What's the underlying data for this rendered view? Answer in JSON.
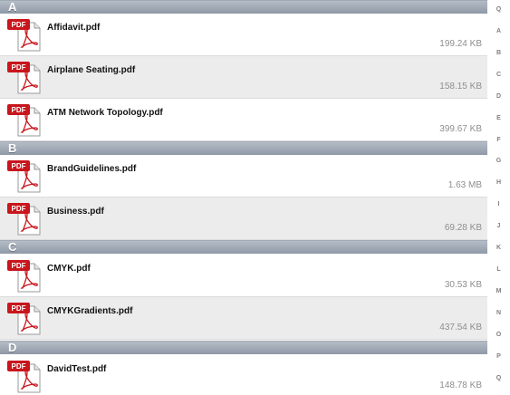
{
  "sections": [
    {
      "letter": "A",
      "files": [
        {
          "name": "Affidavit.pdf",
          "size": "199.24 KB"
        },
        {
          "name": "Airplane Seating.pdf",
          "size": "158.15 KB"
        },
        {
          "name": "ATM Network Topology.pdf",
          "size": "399.67 KB"
        }
      ]
    },
    {
      "letter": "B",
      "files": [
        {
          "name": "BrandGuidelines.pdf",
          "size": "1.63 MB"
        },
        {
          "name": "Business.pdf",
          "size": "69.28 KB"
        }
      ]
    },
    {
      "letter": "C",
      "files": [
        {
          "name": "CMYK.pdf",
          "size": "30.53 KB"
        },
        {
          "name": "CMYKGradients.pdf",
          "size": "437.54 KB"
        }
      ]
    },
    {
      "letter": "D",
      "files": [
        {
          "name": "DavidTest.pdf",
          "size": "148.78 KB"
        }
      ]
    }
  ],
  "file_icon": {
    "name": "pdf-icon",
    "badge_text": "PDF",
    "badge_color": "#c8161d"
  },
  "index_letters": [
    "Q",
    "A",
    "B",
    "C",
    "D",
    "E",
    "F",
    "G",
    "H",
    "I",
    "J",
    "K",
    "L",
    "M",
    "N",
    "O",
    "P",
    "Q"
  ]
}
